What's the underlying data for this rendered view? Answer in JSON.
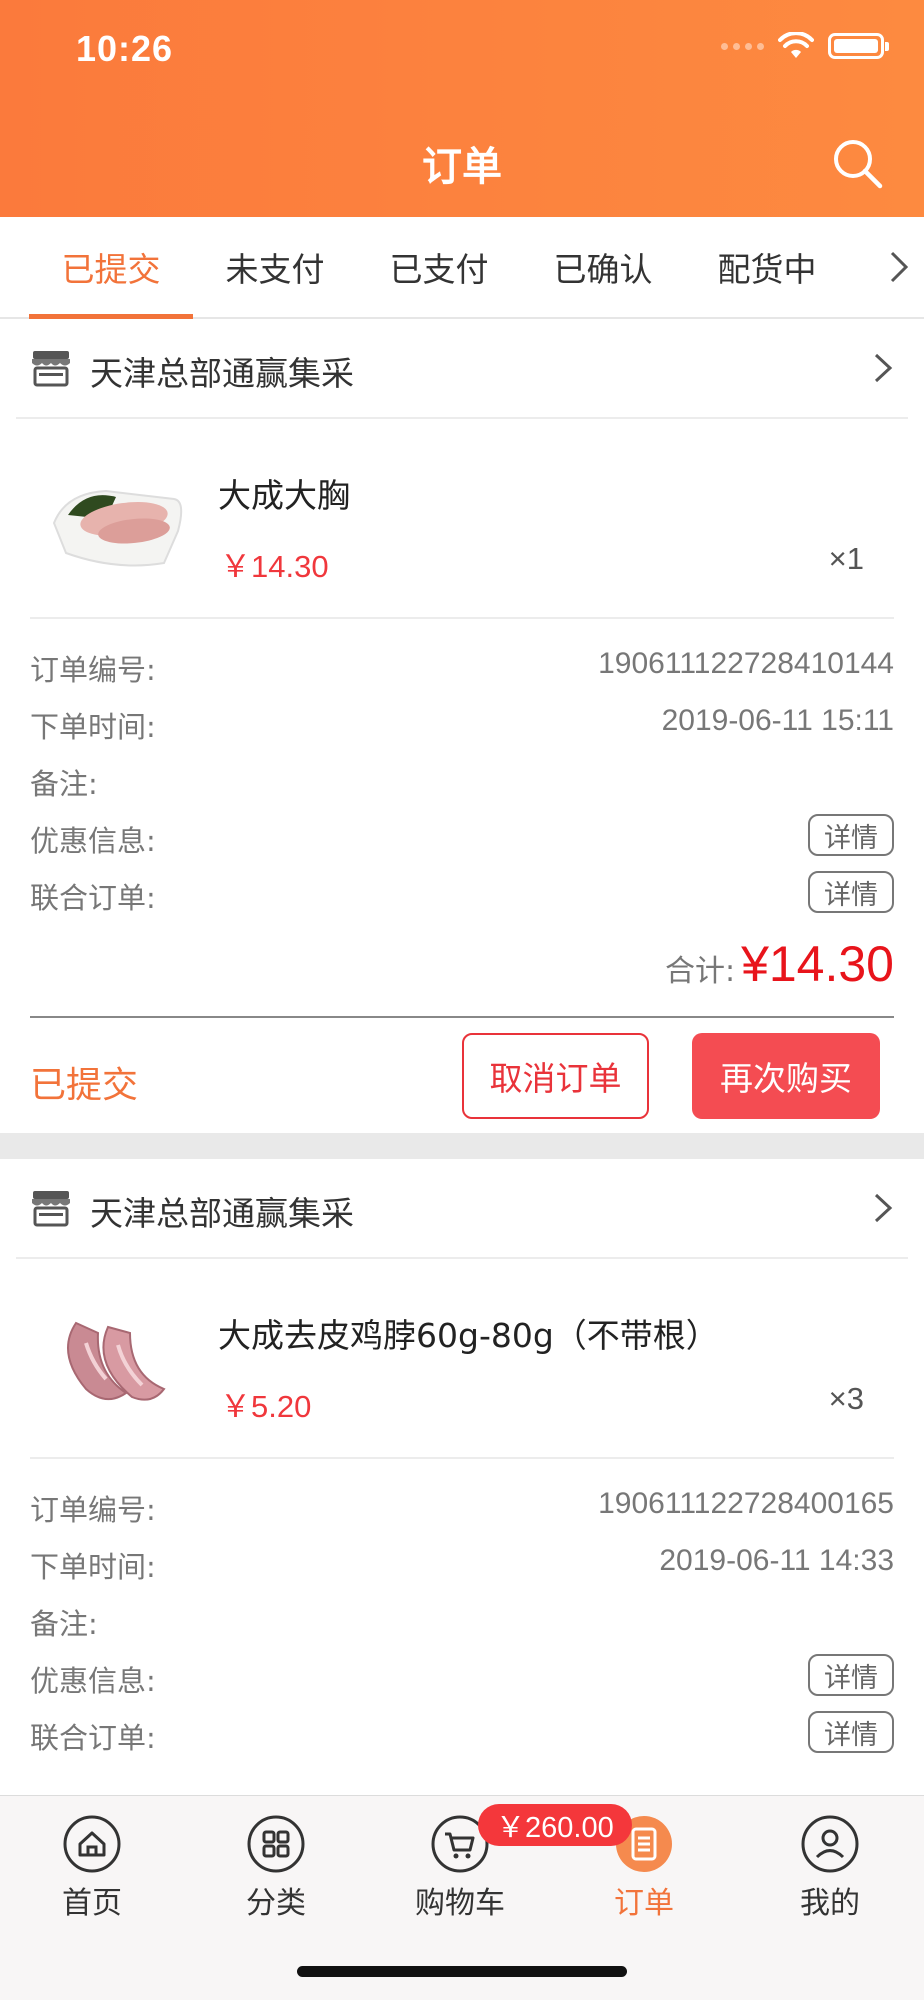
{
  "status_bar": {
    "time": "10:26"
  },
  "header": {
    "title": "订单",
    "search_icon": "search-icon"
  },
  "tabs": [
    {
      "label": "已提交",
      "active": true
    },
    {
      "label": "未支付",
      "active": false
    },
    {
      "label": "已支付",
      "active": false
    },
    {
      "label": "已确认",
      "active": false
    },
    {
      "label": "配货中",
      "active": false
    }
  ],
  "labels": {
    "order_no": "订单编号:",
    "order_time": "下单时间:",
    "remark": "备注:",
    "discount": "优惠信息:",
    "joint_order": "联合订单:",
    "detail": "详情",
    "total": "合计:",
    "cancel": "取消订单",
    "rebuy": "再次购买"
  },
  "orders": [
    {
      "shop": "天津总部通赢集采",
      "product": {
        "name": "大成大胸",
        "price": "￥14.30",
        "qty": "×1"
      },
      "order_no": "190611122728410144",
      "order_time": "2019-06-11 15:11",
      "remark": "",
      "total": "¥14.30",
      "status": "已提交"
    },
    {
      "shop": "天津总部通赢集采",
      "product": {
        "name": "大成去皮鸡脖60g-80g（不带根）",
        "price": "￥5.20",
        "qty": "×3"
      },
      "order_no": "190611122728400165",
      "order_time": "2019-06-11 14:33",
      "remark": ""
    }
  ],
  "bottom_nav": {
    "items": [
      {
        "label": "首页",
        "icon": "home-icon"
      },
      {
        "label": "分类",
        "icon": "grid-icon"
      },
      {
        "label": "购物车",
        "icon": "cart-icon"
      },
      {
        "label": "订单",
        "icon": "order-list-icon",
        "active": true
      },
      {
        "label": "我的",
        "icon": "profile-icon"
      }
    ],
    "cart_badge": "￥260.00"
  },
  "colors": {
    "accent": "#f2733a",
    "price": "#f0373c",
    "danger": "#f44c52"
  }
}
